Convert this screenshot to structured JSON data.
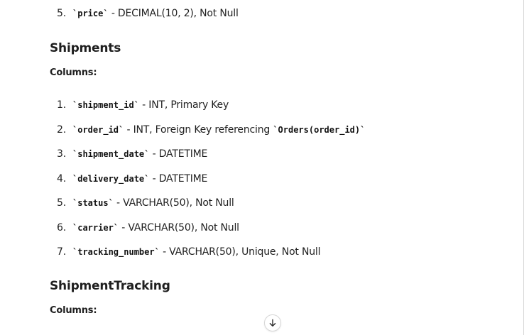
{
  "prev_list": {
    "items": [
      {
        "num": "5.",
        "code": "`price`",
        "desc": " - DECIMAL(10, 2), Not Null"
      }
    ]
  },
  "shipments": {
    "heading": "Shipments",
    "columns_label": "Columns:",
    "items": [
      {
        "num": "1.",
        "code": "`shipment_id`",
        "desc": " - INT, Primary Key",
        "ref": ""
      },
      {
        "num": "2.",
        "code": "`order_id`",
        "desc": " - INT, Foreign Key referencing ",
        "ref": "`Orders(order_id)`"
      },
      {
        "num": "3.",
        "code": "`shipment_date`",
        "desc": " - DATETIME",
        "ref": ""
      },
      {
        "num": "4.",
        "code": "`delivery_date`",
        "desc": " - DATETIME",
        "ref": ""
      },
      {
        "num": "5.",
        "code": "`status`",
        "desc": " - VARCHAR(50), Not Null",
        "ref": ""
      },
      {
        "num": "6.",
        "code": "`carrier`",
        "desc": " - VARCHAR(50), Not Null",
        "ref": ""
      },
      {
        "num": "7.",
        "code": "`tracking_number`",
        "desc": " - VARCHAR(50), Unique, Not Null",
        "ref": ""
      }
    ]
  },
  "shipment_tracking": {
    "heading": "ShipmentTracking",
    "columns_label": "Columns:"
  },
  "scroll_button": {
    "icon": "arrow-down-icon"
  }
}
